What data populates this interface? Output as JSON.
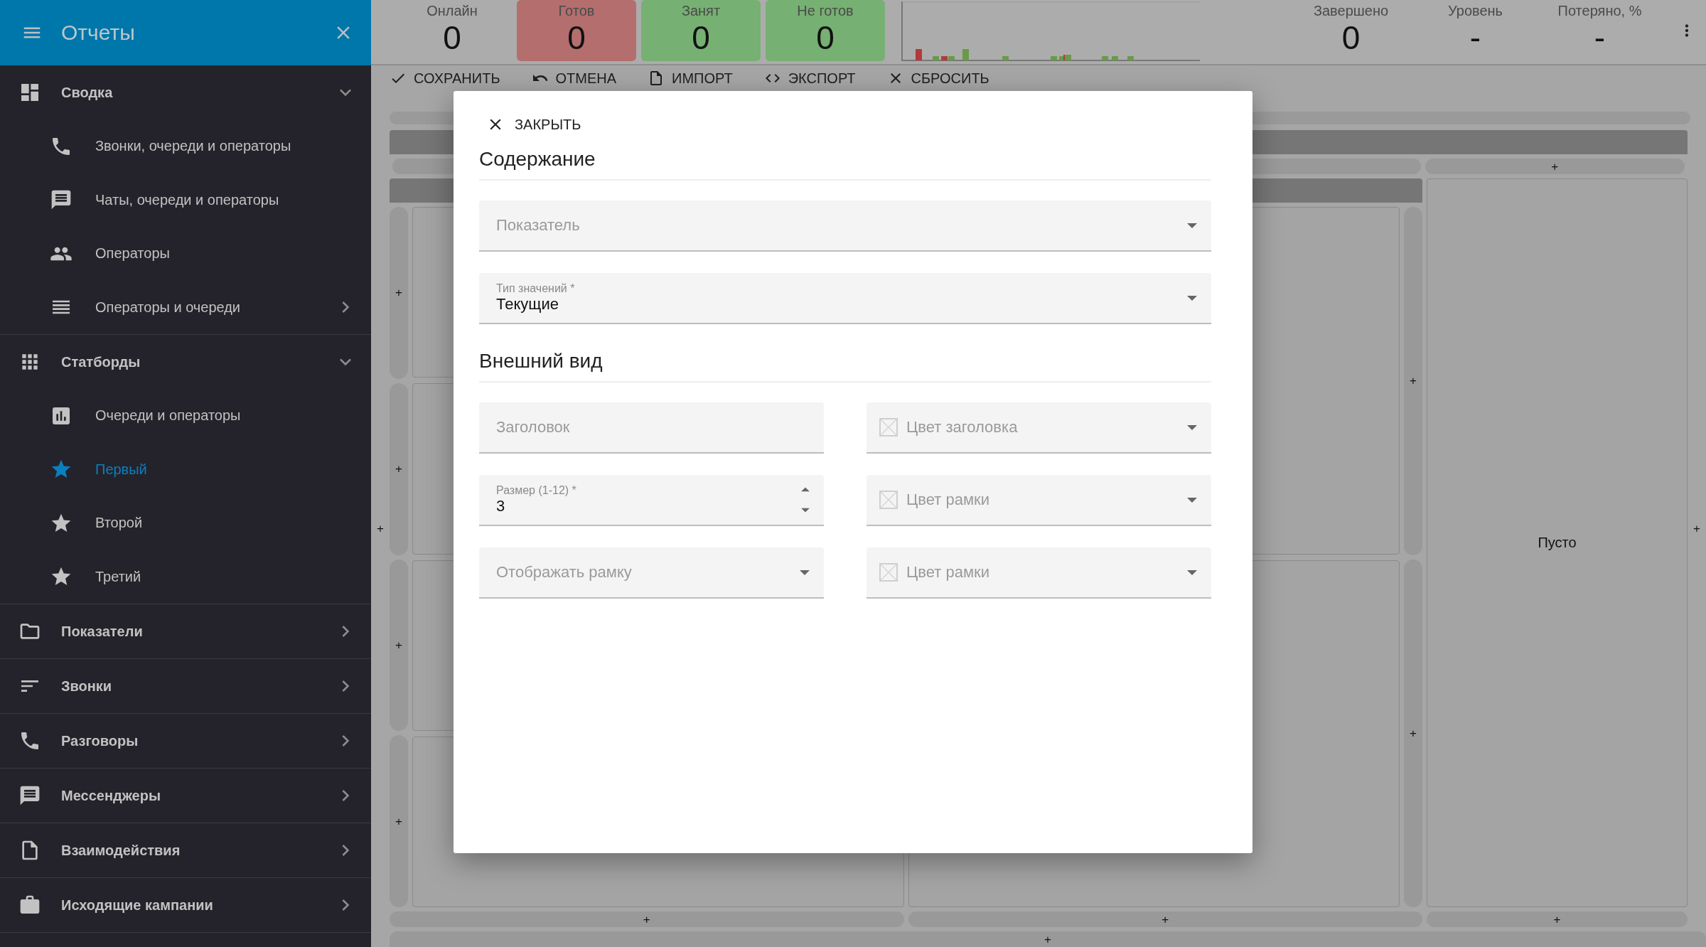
{
  "sidebar": {
    "title": "Отчеты",
    "sections": [
      {
        "label": "Сводка",
        "expanded": true,
        "children": [
          {
            "label": "Звонки, очереди и операторы",
            "selected": false,
            "has_submenu": false
          },
          {
            "label": "Чаты, очереди и операторы",
            "selected": false,
            "has_submenu": false
          },
          {
            "label": "Операторы",
            "selected": false,
            "has_submenu": false
          },
          {
            "label": "Операторы и очереди",
            "selected": false,
            "has_submenu": true
          }
        ]
      },
      {
        "label": "Статборды",
        "expanded": true,
        "children": [
          {
            "label": "Очереди и операторы",
            "selected": false,
            "has_submenu": false
          },
          {
            "label": "Первый",
            "selected": true,
            "has_submenu": false
          },
          {
            "label": "Второй",
            "selected": false,
            "has_submenu": false
          },
          {
            "label": "Третий",
            "selected": false,
            "has_submenu": false
          }
        ]
      },
      {
        "label": "Показатели",
        "expanded": false
      },
      {
        "label": "Звонки",
        "expanded": false
      },
      {
        "label": "Разговоры",
        "expanded": false
      },
      {
        "label": "Мессенджеры",
        "expanded": false
      },
      {
        "label": "Взаимодействия",
        "expanded": false
      },
      {
        "label": "Исходящие кампании",
        "expanded": false
      }
    ]
  },
  "stats": [
    {
      "label": "Онлайн",
      "value": "0"
    },
    {
      "label": "Готов",
      "value": "0",
      "color": "#b46e6e"
    },
    {
      "label": "Занят",
      "value": "0",
      "color": "#76b072"
    },
    {
      "label": "Не готов",
      "value": "0",
      "color": "#76b072"
    }
  ],
  "stats_right": [
    {
      "label": "Завершено",
      "value": "0"
    },
    {
      "label": "Уровень",
      "value": "-"
    },
    {
      "label": "Потеряно, %",
      "value": "-"
    }
  ],
  "toolbar": [
    "СОХРАНИТЬ",
    "ОТМЕНА",
    "ИМПОРТ",
    "ЭКСПОРТ",
    "СБРОСИТЬ"
  ],
  "board": {
    "left_gutter_add": "+",
    "right_gutter_add": "+",
    "bottom_add": "+",
    "top_row_add": "+",
    "columns": [
      {
        "kind": "stack",
        "side_adds": [
          "+",
          "+",
          "+",
          "+"
        ],
        "bottom_add": "+"
      },
      {
        "kind": "stack",
        "side_adds": [
          "+",
          "+"
        ],
        "bottom_add": "+"
      },
      {
        "kind": "empty",
        "text": "Пусто",
        "bottom_add": "+"
      }
    ]
  },
  "dialog": {
    "close": "ЗАКРЫТЬ",
    "sections": [
      {
        "title": "Содержание",
        "fields": [
          {
            "kind": "select",
            "placeholder": "Показатель"
          },
          {
            "kind": "select",
            "label": "Тип значений *",
            "value": "Текущие"
          }
        ]
      },
      {
        "title": "Внешний вид",
        "fields": [
          {
            "kind": "text",
            "placeholder": "Заголовок"
          },
          {
            "kind": "color",
            "placeholder": "Цвет заголовка"
          },
          {
            "kind": "number",
            "label": "Размер (1-12) *",
            "value": "3"
          },
          {
            "kind": "color",
            "placeholder": "Цвет рамки"
          },
          {
            "kind": "select",
            "placeholder": "Отображать рамку"
          },
          {
            "kind": "color",
            "placeholder": "Цвет рамки"
          }
        ]
      }
    ]
  }
}
